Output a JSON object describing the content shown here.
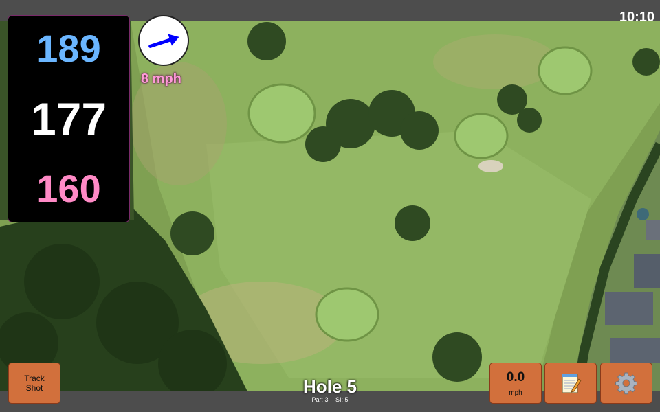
{
  "clock": "10:10",
  "distances": {
    "back": "189",
    "middle": "177",
    "front": "160"
  },
  "wind": {
    "speed": "8 mph",
    "icon": "wind-arrow-icon"
  },
  "hole": {
    "title": "Hole 5",
    "par": "Par: 3",
    "si": "SI: 5"
  },
  "buttons": {
    "track_shot": [
      "Track",
      "Shot"
    ],
    "speed_value": "0.0",
    "speed_unit": "mph",
    "notes_icon": "notepad-icon",
    "settings_icon": "gear-icon"
  },
  "colors": {
    "back_distance": "#6bb6ff",
    "middle_distance": "#ffffff",
    "front_distance": "#ff8ac6",
    "button": "#d2703c",
    "wind_arrow": "#0000ff"
  }
}
